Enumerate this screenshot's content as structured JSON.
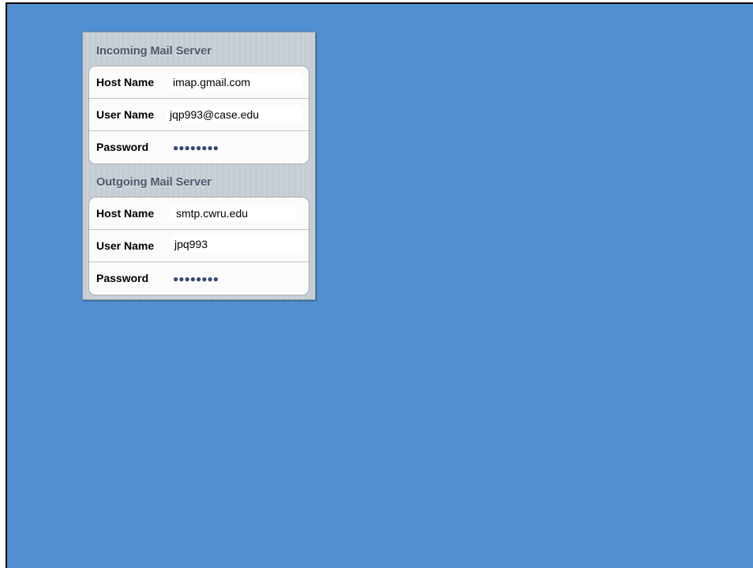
{
  "incoming": {
    "header": "Incoming Mail Server",
    "host_label": "Host Name",
    "host_value": "imap.gmail.com",
    "user_label": "User Name",
    "user_value": "jqp993@case.edu",
    "password_label": "Password",
    "password_value": "●●●●●●●●"
  },
  "outgoing": {
    "header": "Outgoing Mail Server",
    "host_label": "Host Name",
    "host_value": "smtp.cwru.edu",
    "user_label": "User Name",
    "user_value": "jpq993",
    "password_label": "Password",
    "password_value": "●●●●●●●●"
  },
  "colors": {
    "background": "#528fd0",
    "panel": "#c5ccd4",
    "header_text": "#4c566c",
    "password_dots": "#34486e"
  }
}
